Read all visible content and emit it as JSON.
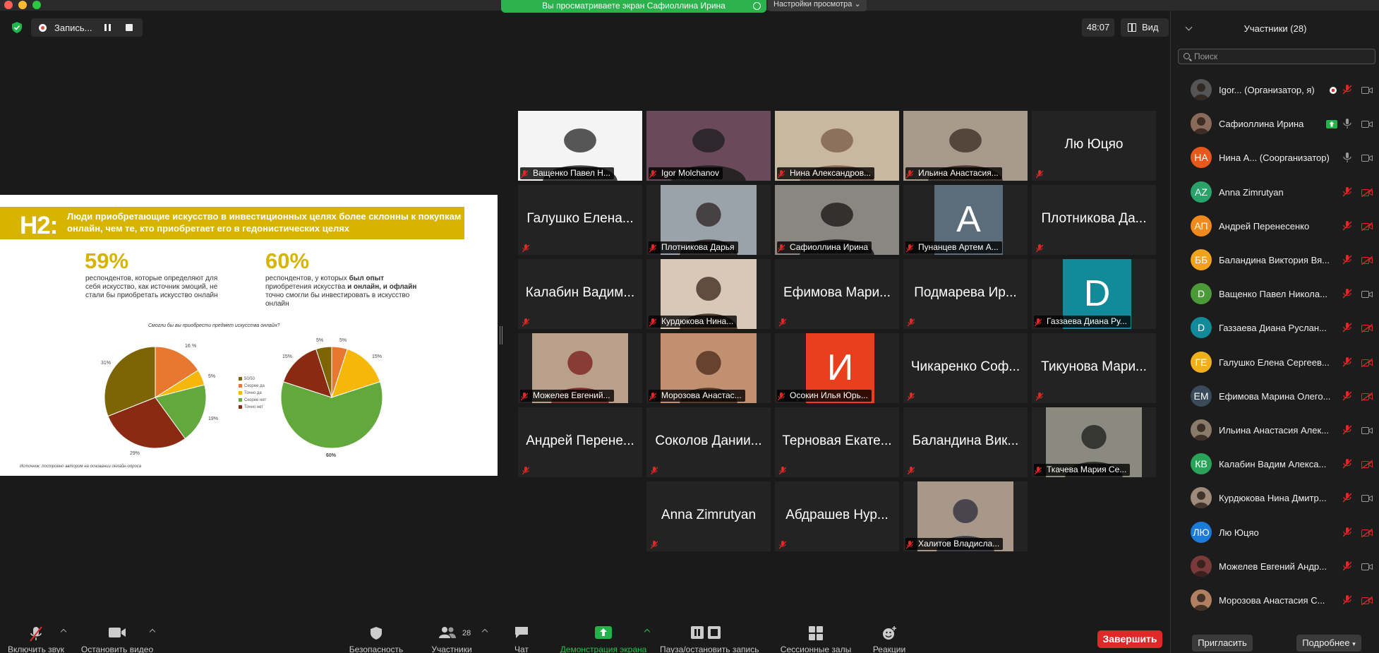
{
  "share_banner": {
    "text": "Вы просматриваете экран Сафиоллина Ирина",
    "view_options": "Настройки просмотра"
  },
  "recording": {
    "label": "Запись..."
  },
  "meeting": {
    "timer": "48:07",
    "view_label": "Вид"
  },
  "slide": {
    "heading_prefix": "H2:",
    "heading_text": "Люди приобретающие искусство в инвестиционных целях более склонны к покупкам онлайн, чем те, кто приобретает его в гедонистических целях",
    "stat1_value": "59%",
    "stat1_text": "респондентов, которые определяют для себя искусство, как источник эмоций, не стали бы приобретать искусство онлайн",
    "stat2_value": "60%",
    "stat2_text_a": "респондентов, у которых ",
    "stat2_text_b": "был опыт",
    "stat2_text_c": " приобретения искусства ",
    "stat2_text_d": "и онлайн, и офлайн",
    "stat2_text_e": " точно смогли бы инвестировать в искусство онлайн",
    "chart_question": "Смогли бы вы приобрести предмет искусства онлайн?",
    "legend": [
      "50/50",
      "Скорее да",
      "Точно да",
      "Скорее нет",
      "Точно нет"
    ],
    "source": "Источник: построено автором на основании онлайн-опроса",
    "colors": {
      "accent": "#d6b400",
      "orange": "#e87830",
      "yellow": "#f5b80a",
      "green": "#62a83c",
      "darkred": "#8b2a12",
      "olive": "#7d6405"
    }
  },
  "chart_data": [
    {
      "type": "pie",
      "title": "",
      "slices": [
        {
          "label": "Скорее да",
          "value": 16,
          "color": "#e87830"
        },
        {
          "label": "Точно да",
          "value": 5,
          "color": "#f5b80a"
        },
        {
          "label": "Скорее нет",
          "value": 19,
          "color": "#62a83c"
        },
        {
          "label": "Точно нет",
          "value": 29,
          "color": "#8b2a12"
        },
        {
          "label": "50/50",
          "value": 31,
          "color": "#7d6405"
        }
      ]
    },
    {
      "type": "pie",
      "title": "",
      "slices": [
        {
          "label": "Скорее да",
          "value": 5,
          "color": "#e87830"
        },
        {
          "label": "Точно да",
          "value": 15,
          "color": "#f5b80a"
        },
        {
          "label": "Скорее нет",
          "value": 60,
          "color": "#62a83c"
        },
        {
          "label": "Точно нет",
          "value": 15,
          "color": "#8b2a12"
        },
        {
          "label": "50/50",
          "value": 5,
          "color": "#7d6405"
        }
      ]
    }
  ],
  "tiles": [
    {
      "name": "Ващенко Павел Н...",
      "kind": "video",
      "photo_bg": "#f4f4f4",
      "photo_dark": "#222"
    },
    {
      "name": "Igor Molchanov",
      "kind": "video",
      "photo_bg": "#6a4a5a",
      "photo_dark": "#1c1c1c"
    },
    {
      "name": "Нина Александров...",
      "kind": "video",
      "photo_bg": "#c8b8a0",
      "photo_dark": "#7a5a4a"
    },
    {
      "name": "Ильина Анастасия...",
      "kind": "video",
      "photo_bg": "#a89a8a",
      "photo_dark": "#3a2a22"
    },
    {
      "name": "Лю Юцяо",
      "kind": "name"
    },
    {
      "name": "Галушко Елена...",
      "kind": "name"
    },
    {
      "name": "Плотникова Дарья",
      "kind": "video",
      "photo_bg": "#9aa2aa",
      "photo_dark": "#2a2020"
    },
    {
      "name": "Сафиоллина Ирина",
      "kind": "video",
      "photo_bg": "#8a8680",
      "photo_dark": "#141414",
      "active": true
    },
    {
      "name": "Пунанцев Артем А...",
      "kind": "avatar",
      "letter": "A",
      "color": "#5b6d7a"
    },
    {
      "name": "Плотникова Да...",
      "kind": "name"
    },
    {
      "name": "Калабин Вадим...",
      "kind": "name"
    },
    {
      "name": "Курдюкова Нина...",
      "kind": "video",
      "photo_bg": "#d8c8b8",
      "photo_dark": "#3a2418"
    },
    {
      "name": "Ефимова Мари...",
      "kind": "name"
    },
    {
      "name": "Подмарева Ир...",
      "kind": "name"
    },
    {
      "name": "Газзаева Диана Ру...",
      "kind": "avatar",
      "letter": "D",
      "color": "#138a9a"
    },
    {
      "name": "Можелев Евгений...",
      "kind": "video",
      "photo_bg": "#b8a08a",
      "photo_dark": "#7a1a1a"
    },
    {
      "name": "Морозова Анастас...",
      "kind": "video",
      "photo_bg": "#c09070",
      "photo_dark": "#4a2a1a"
    },
    {
      "name": "Осокин Илья Юрь...",
      "kind": "avatar",
      "letter": "И",
      "color": "#e8401c"
    },
    {
      "name": "Чикаренко Соф...",
      "kind": "name"
    },
    {
      "name": "Тикунова Мари...",
      "kind": "name"
    },
    {
      "name": "Андрей Перене...",
      "kind": "name"
    },
    {
      "name": "Соколов Дании...",
      "kind": "name"
    },
    {
      "name": "Терновая Екате...",
      "kind": "name"
    },
    {
      "name": "Баландина Вик...",
      "kind": "name"
    },
    {
      "name": "Ткачева Мария Се...",
      "kind": "video",
      "photo_bg": "#8a8a80",
      "photo_dark": "#1a1a1a"
    },
    {
      "name": "Anna Zimrutyan",
      "kind": "name"
    },
    {
      "name": "Абдрашев Нур...",
      "kind": "name"
    },
    {
      "name": "Халитов Владисла...",
      "kind": "video",
      "photo_bg": "#a8988a",
      "photo_dark": "#2a2a3a"
    }
  ],
  "participants": {
    "title": "Участники (28)",
    "search_placeholder": "Поиск",
    "list": [
      {
        "name": "Igor... (Организатор, я)",
        "initials": "",
        "color": "#555",
        "photo": true,
        "mic": "muted",
        "cam": "on",
        "rec": true
      },
      {
        "name": "Сафиоллина Ирина",
        "initials": "",
        "color": "#8a6a5a",
        "photo": true,
        "mic": "on",
        "cam": "on",
        "share": true
      },
      {
        "name": "Нина А... (Соорганизатор)",
        "initials": "НА",
        "color": "#e8571c",
        "mic": "on",
        "cam": "on"
      },
      {
        "name": "Anna Zimrutyan",
        "initials": "AZ",
        "color": "#2aa36a",
        "mic": "muted",
        "cam": "off"
      },
      {
        "name": "Андрей Перенесенко",
        "initials": "АП",
        "color": "#f08a1c",
        "mic": "muted",
        "cam": "off"
      },
      {
        "name": "Баландина Виктория Вя...",
        "initials": "ББ",
        "color": "#f0a21c",
        "mic": "muted",
        "cam": "off"
      },
      {
        "name": "Ващенко Павел Никола...",
        "initials": "D",
        "color": "#4a9a3a",
        "mic": "muted",
        "cam": "on"
      },
      {
        "name": "Газзаева Диана Руслан...",
        "initials": "D",
        "color": "#138a9a",
        "mic": "muted",
        "cam": "off"
      },
      {
        "name": "Галушко Елена Сергеев...",
        "initials": "ГЕ",
        "color": "#f0b01c",
        "mic": "muted",
        "cam": "off"
      },
      {
        "name": "Ефимова Марина Олего...",
        "initials": "ЕМ",
        "color": "#3a4a5a",
        "mic": "muted",
        "cam": "off"
      },
      {
        "name": "Ильина Анастасия Алек...",
        "initials": "",
        "color": "#8a7a6a",
        "photo": true,
        "mic": "muted",
        "cam": "on"
      },
      {
        "name": "Калабин Вадим Алекса...",
        "initials": "КВ",
        "color": "#2aa35a",
        "mic": "muted",
        "cam": "off"
      },
      {
        "name": "Курдюкова Нина Дмитр...",
        "initials": "",
        "color": "#a08a7a",
        "photo": true,
        "mic": "muted",
        "cam": "on"
      },
      {
        "name": "Лю Юцяо",
        "initials": "ЛЮ",
        "color": "#1c7ad8",
        "mic": "muted",
        "cam": "off"
      },
      {
        "name": "Можелев Евгений Андр...",
        "initials": "",
        "color": "#7a3a3a",
        "photo": true,
        "mic": "muted",
        "cam": "on"
      },
      {
        "name": "Морозова Анастасия С...",
        "initials": "",
        "color": "#b08060",
        "photo": true,
        "mic": "muted",
        "cam": "off"
      }
    ],
    "invite_label": "Пригласить",
    "more_label": "Подробнее"
  },
  "toolbar": {
    "unmute": "Включить звук",
    "stop_video": "Остановить видео",
    "security": "Безопасность",
    "participants": "Участники",
    "participants_count": "28",
    "chat": "Чат",
    "share_screen": "Демонстрация экрана",
    "pause_recording": "Пауза/остановить запись",
    "breakout_rooms": "Сессионные залы",
    "reactions": "Реакции",
    "end": "Завершить"
  }
}
